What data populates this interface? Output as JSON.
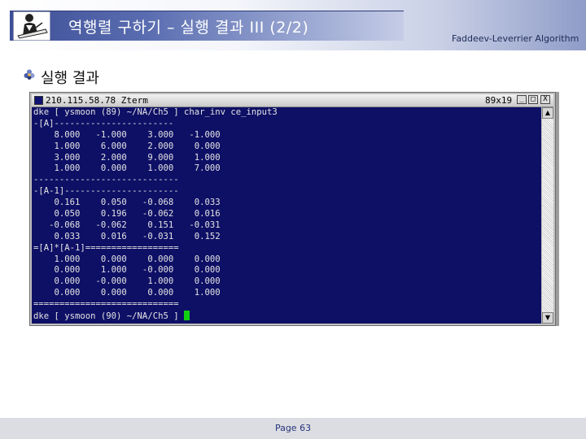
{
  "slide": {
    "title": "역행렬 구하기 – 실행 결과 III (2/2)",
    "header_right": "Faddeev-Leverrier Algorithm",
    "bullet": "실행 결과",
    "page": "Page 63"
  },
  "terminal": {
    "title": "210.115.58.78   Zterm",
    "size_label": "89x19",
    "buttons": {
      "minimize": "_",
      "maximize": "□",
      "close": "X"
    },
    "lines": [
      "dke [ ysmoon (89) ~/NA/Ch5 ] char_inv ce_input3",
      "-[A]-----------------------",
      "    8.000   -1.000    3.000   -1.000",
      "    1.000    6.000    2.000    0.000",
      "    3.000    2.000    9.000    1.000",
      "    1.000    0.000    1.000    7.000",
      "----------------------------",
      "-[A-1]----------------------",
      "    0.161    0.050   -0.068    0.033",
      "    0.050    0.196   -0.062    0.016",
      "   -0.068   -0.062    0.151   -0.031",
      "    0.033    0.016   -0.031    0.152",
      "=[A]*[A-1]==================",
      "    1.000    0.000    0.000    0.000",
      "    0.000    1.000   -0.000    0.000",
      "    0.000   -0.000    1.000    0.000",
      "    0.000    0.000    0.000    1.000",
      "============================",
      "dke [ ysmoon (90) ~/NA/Ch5 ] "
    ],
    "colors": {
      "background": "#0e1066",
      "foreground": "#e3e3e3",
      "cursor": "#11d011"
    }
  },
  "icons": {
    "logo": "person-at-desk-icon",
    "bullet": "flower-bullet-icon",
    "system_menu": "terminal-system-menu-icon"
  }
}
